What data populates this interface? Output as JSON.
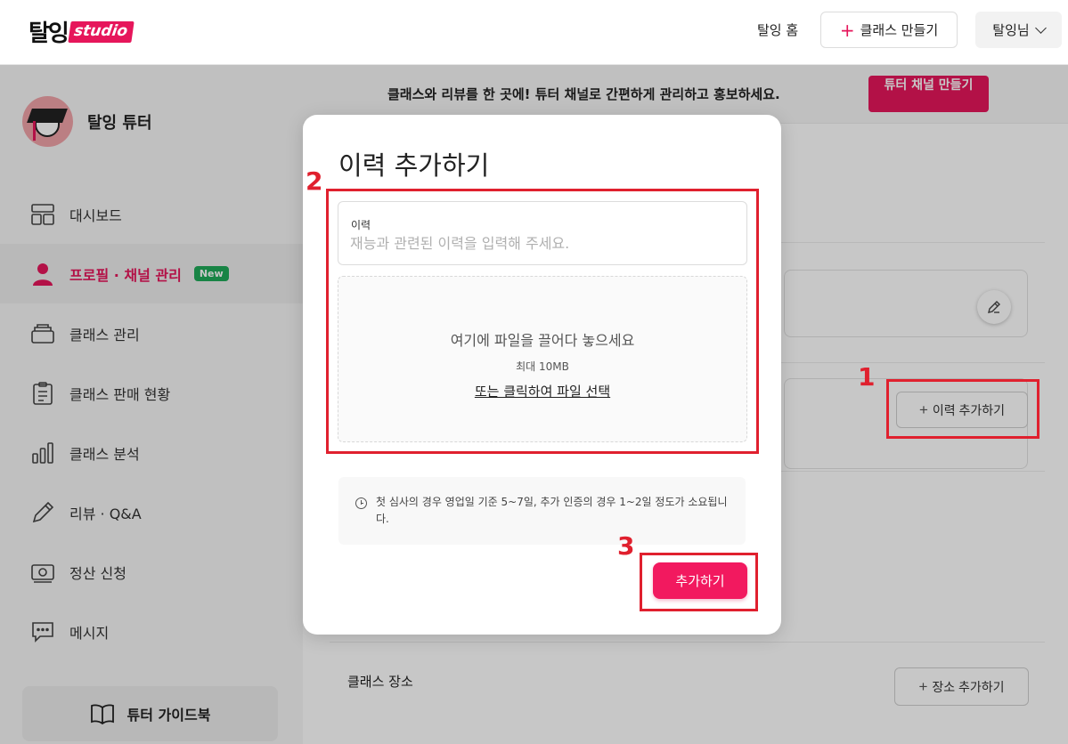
{
  "header": {
    "logo_text": "탈잉",
    "logo_badge": "studio",
    "home_link": "탈잉 홈",
    "create_class": "클래스 만들기",
    "user_menu": "탈잉님"
  },
  "sidebar": {
    "profile_name": "탈잉 튜터",
    "items": [
      {
        "label": "대시보드",
        "icon": "dashboard-icon"
      },
      {
        "label": "프로필 · 채널 관리",
        "icon": "person-icon",
        "badge": "New",
        "active": true
      },
      {
        "label": "클래스 관리",
        "icon": "stack-icon"
      },
      {
        "label": "클래스 판매 현황",
        "icon": "clipboard-icon"
      },
      {
        "label": "클래스 분석",
        "icon": "bar-chart-icon"
      },
      {
        "label": "리뷰 · Q&A",
        "icon": "pencil-icon"
      },
      {
        "label": "정산 신청",
        "icon": "money-icon"
      },
      {
        "label": "메시지",
        "icon": "chat-icon"
      }
    ],
    "guide_button": "튜터 가이드북"
  },
  "main": {
    "banner_text": "클래스와 리뷰를 한 곳에! 튜터 채널로 간편하게 관리하고 홍보하세요.",
    "banner_button": "튜터 채널 만들기",
    "history_add_button": "이력 추가하기",
    "place_label": "클래스 장소",
    "place_add_button": "장소 추가하기"
  },
  "modal": {
    "title": "이력 추가하기",
    "field_label": "이력",
    "field_placeholder": "재능과 관련된 이력을 입력해 주세요.",
    "field_value": "",
    "dropzone_main": "여기에 파일을 끌어다 놓으세요",
    "dropzone_max": "최대 10MB",
    "dropzone_link": "또는 클릭하여 파일 선택",
    "notice": "첫 심사의 경우 영업일 기준 5~7일, 추가 인증의 경우 1~2일 정도가 소요됩니다.",
    "submit_button": "추가하기"
  },
  "annotations": [
    "1",
    "2",
    "3"
  ],
  "colors": {
    "accent": "#e6165b",
    "annotation": "#e0202e",
    "badge_new": "#1faa59"
  }
}
